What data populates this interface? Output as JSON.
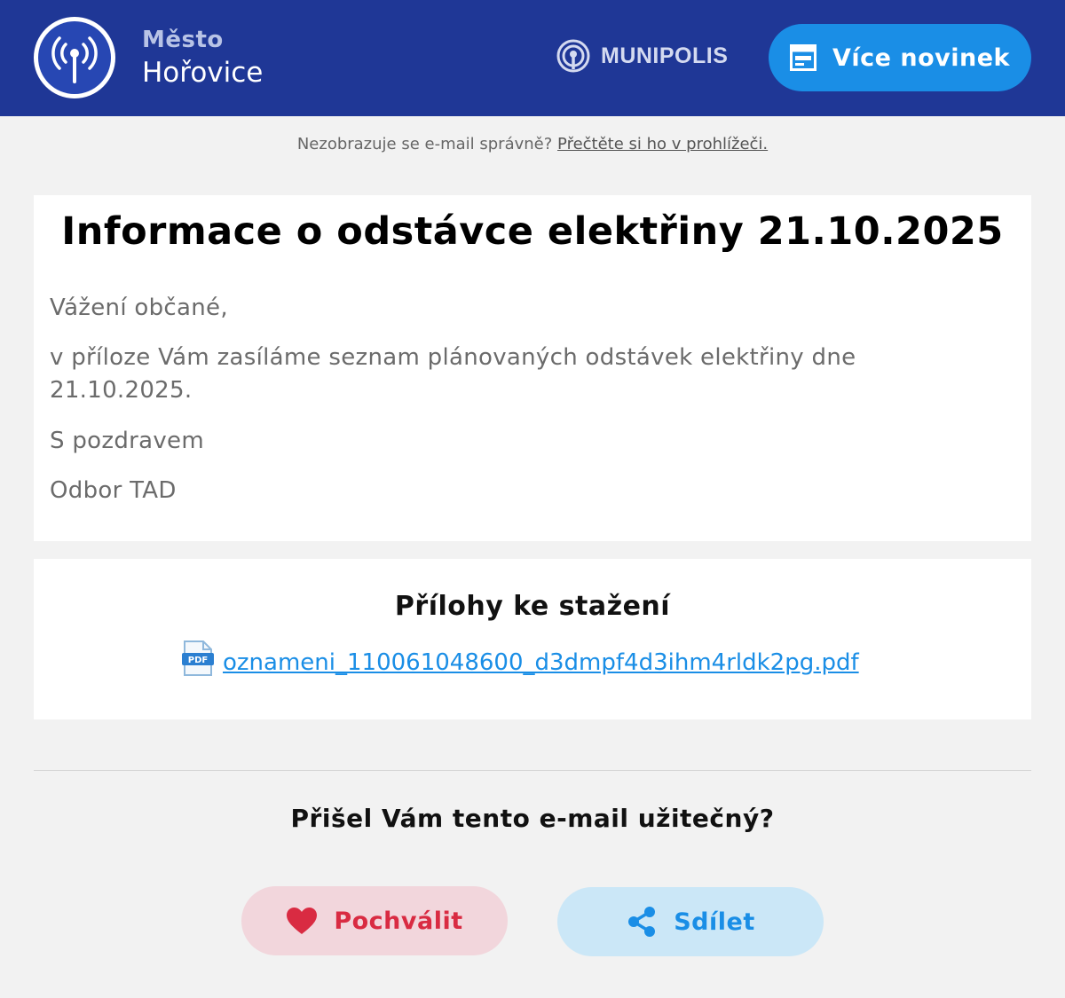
{
  "header": {
    "city_small": "Město",
    "city_name": "Hořovice",
    "brand": "MUNIPOLIS",
    "more_news_label": "Více novinek"
  },
  "preheader": {
    "text": "Nezobrazuje se e-mail správně?",
    "link": "Přečtěte si ho v prohlížeči."
  },
  "article": {
    "title": "Informace o odstávce elektřiny 21.10.2025",
    "greeting": "Vážení občané,",
    "body": "v příloze Vám zasíláme seznam plánovaných odstávek elektřiny dne 21.10.2025.",
    "closing": "S pozdravem",
    "signature": "Odbor TAD"
  },
  "attachments": {
    "title": "Přílohy ke stažení",
    "files": [
      {
        "name": "oznameni_110061048600_d3dmpf4d3ihm4rldk2pg.pdf",
        "icon": "pdf-icon"
      }
    ]
  },
  "feedback": {
    "question": "Přišel Vám tento e-mail užitečný?",
    "praise_label": "Pochválit",
    "share_label": "Sdílet"
  },
  "colors": {
    "header_bg": "#1f3796",
    "accent_blue": "#1a8ee6",
    "praise_red": "#d92b42",
    "page_bg": "#f2f2f2"
  }
}
